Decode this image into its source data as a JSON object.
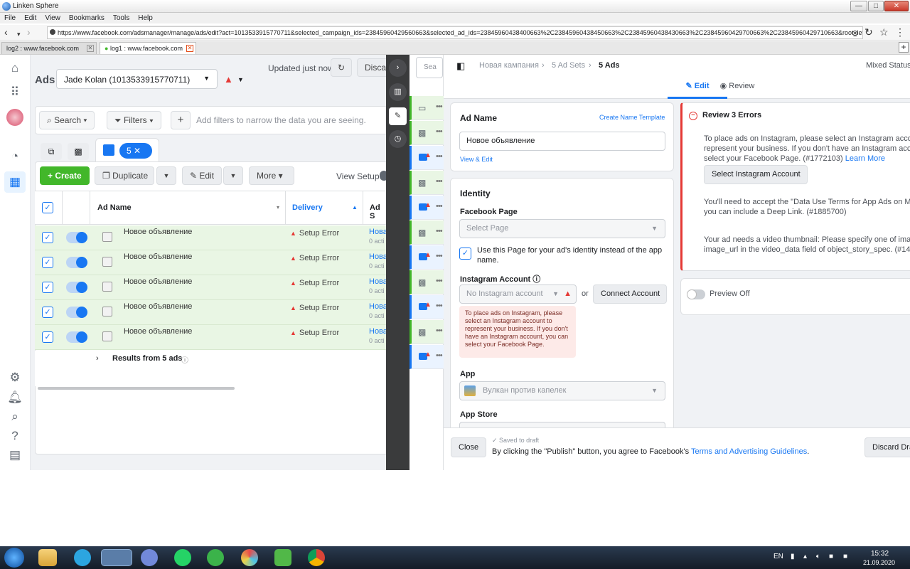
{
  "window": {
    "title": "Linken Sphere",
    "minimize": "—",
    "maximize": "□",
    "close": "✕"
  },
  "menubar": [
    "File",
    "Edit",
    "View",
    "Bookmarks",
    "Tools",
    "Help"
  ],
  "browser": {
    "url": "https://www.facebook.com/adsmanager/manage/ads/edit?act=1013533915770711&selected_campaign_ids=23845960429560663&selected_ad_ids=23845960438400663%2C23845960438450663%2C23845960438430663%2C23845960429700663%2C23845960429710663&root_level=ad",
    "tabs": [
      {
        "label": "log2 : www.facebook.com"
      },
      {
        "label": "log1 : www.facebook.com"
      }
    ],
    "new_tab": "+"
  },
  "ads": {
    "title": "Ads",
    "account": "Jade Kolan (1013533915770711)",
    "updated": "Updated just now",
    "discard": "Discard",
    "search": "Search",
    "filters": "Filters",
    "add": "+",
    "filter_placeholder": "Add filters to narrow the data you are seeing.",
    "selected_count": "5",
    "toolbar": {
      "create": "Create",
      "duplicate": "Duplicate",
      "edit": "Edit",
      "more": "More",
      "view_setup": "View Setup"
    },
    "columns": {
      "ad_name": "Ad Name",
      "delivery": "Delivery",
      "ad_set": "Ad S"
    },
    "rows": [
      {
        "name": "Новое объявление",
        "delivery": "Setup Error",
        "adset": "Нова",
        "sub": "0 acti"
      },
      {
        "name": "Новое объявление",
        "delivery": "Setup Error",
        "adset": "Нова",
        "sub": "0 acti"
      },
      {
        "name": "Новое объявление",
        "delivery": "Setup Error",
        "adset": "Нова",
        "sub": "0 acti"
      },
      {
        "name": "Новое объявление",
        "delivery": "Setup Error",
        "adset": "Нова",
        "sub": "0 acti"
      },
      {
        "name": "Новое объявление",
        "delivery": "Setup Error",
        "adset": "Нова",
        "sub": "0 acti"
      }
    ],
    "results": "Results from 5 ads"
  },
  "mini_search": "Sea",
  "editor": {
    "breadcrumb": [
      "Новая кампания",
      "5 Ad Sets",
      "5 Ads"
    ],
    "mixed_status": "Mixed Status",
    "tabs": {
      "edit": "Edit",
      "review": "Review"
    },
    "ad_name": {
      "label": "Ad Name",
      "template": "Create Name Template",
      "value": "Новое объявление",
      "view_edit": "View & Edit"
    },
    "identity": {
      "title": "Identity",
      "fb_page_label": "Facebook Page",
      "fb_page_placeholder": "Select Page",
      "use_page": "Use this Page for your ad's identity instead of the app",
      "use_page_2": "name.",
      "ig_label": "Instagram Account",
      "ig_value": "No Instagram account",
      "or": "or",
      "connect": "Connect Account",
      "tooltip": [
        "To place ads on Instagram, please",
        "select an Instagram account to",
        "represent your business. If you don't",
        "have an Instagram account, you can",
        "select your Facebook Page."
      ],
      "app_label": "App",
      "app_value": "Вулкан против капелек",
      "store_label": "App Store"
    },
    "errors": {
      "title": "Review 3 Errors",
      "e1": [
        "To place ads on Instagram, please select an Instagram accou",
        "represent your business. If you don't have an Instagram accou",
        "select your Facebook Page. (#1772103)"
      ],
      "learn_more": "Learn More",
      "select_ig": "Select Instagram Account",
      "e2": [
        "You'll need to accept the \"Data Use Terms for App Ads on Mob",
        "you can include a Deep Link. (#1885700)"
      ],
      "e3": [
        "Your ad needs a video thumbnail: Please specify one of image",
        "image_url in the video_data field of object_story_spec. (#1443"
      ]
    },
    "preview": "Preview Off",
    "footer": {
      "saved": "Saved to draft",
      "close": "Close",
      "terms_pre": "By clicking the \"Publish\" button, you agree to Facebook's",
      "terms_link": "Terms and Advertising Guidelines",
      "terms_post": ".",
      "discard": "Discard Dra"
    }
  },
  "taskbar": {
    "lang": "EN",
    "time": "15:32",
    "date": "21.09.2020"
  },
  "colors": {
    "fb_blue": "#1877f2",
    "green": "#42b72a",
    "error": "#e53935"
  }
}
